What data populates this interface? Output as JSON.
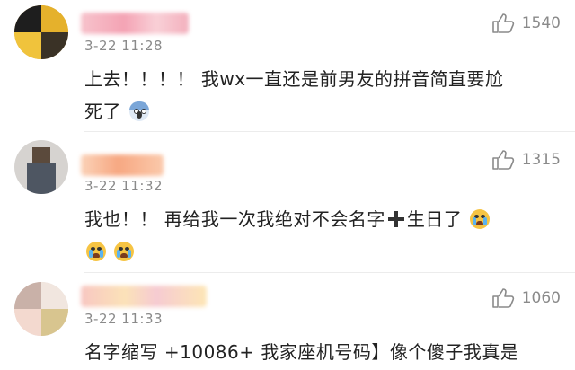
{
  "comments": [
    {
      "time": "3-22 11:28",
      "likes": "1540",
      "text_line1": "上去！！！！ 我wx一直还是前男友的拼音简直要尬",
      "text_line2": "死了",
      "emoji_line2": "scream-emoji"
    },
    {
      "time": "3-22 11:32",
      "likes": "1315",
      "text_part1": "我也！！ 再给我一次我绝对不会名字",
      "text_part2": "生日了",
      "emoji_after": "crying-emoji",
      "emoji_line2": [
        "crying-emoji",
        "crying-emoji"
      ]
    },
    {
      "time": "3-22 11:33",
      "likes": "1060",
      "text_line1": "名字缩写 +10086+ 我家座机号码】像个傻子我真是"
    }
  ],
  "colors": {
    "meta_gray": "#8a8a8a",
    "text": "#222222",
    "emoji_yellow": "#f6c443"
  },
  "icons": {
    "like": "thumbs-up-icon",
    "plus": "heavy-plus-icon"
  }
}
